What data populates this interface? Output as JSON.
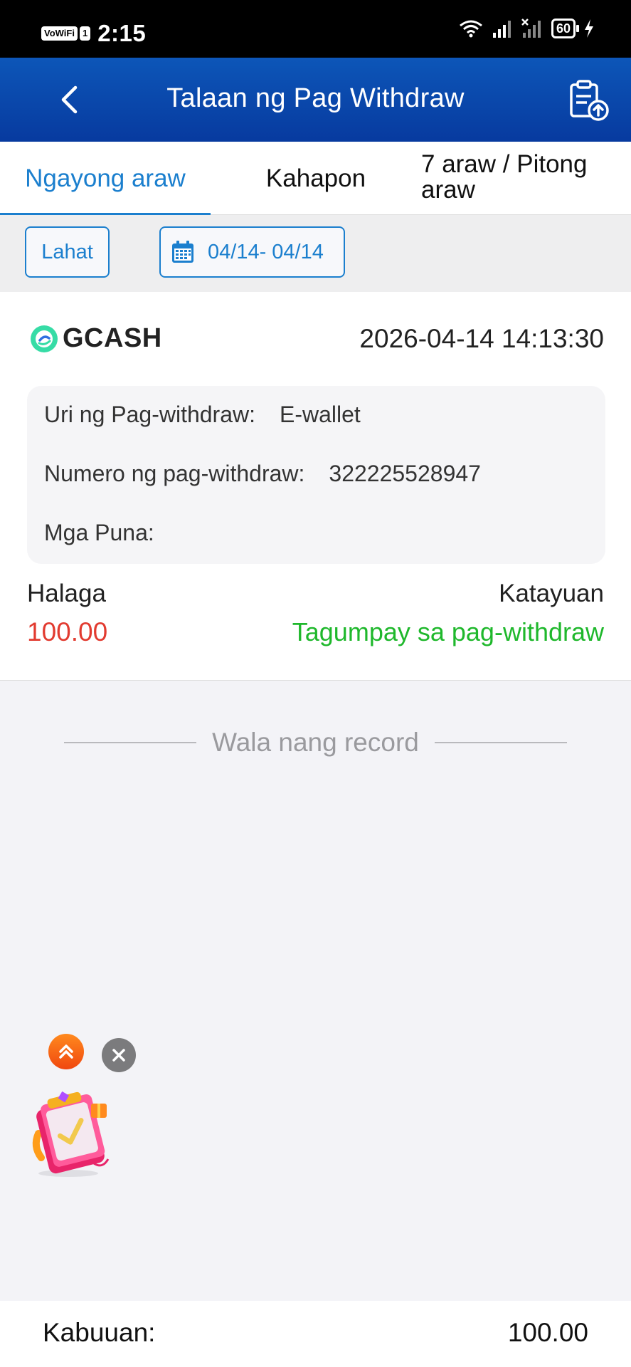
{
  "status_bar": {
    "network_badge": "VoWiFi",
    "sim_badge": "1",
    "time": "2:15",
    "battery": "60",
    "icons": [
      "wifi-icon",
      "signal-icon",
      "signal-x-icon",
      "battery-icon",
      "charging-icon"
    ]
  },
  "header": {
    "title": "Talaan ng Pag Withdraw",
    "back_icon": "chevron-left-icon",
    "action_icon": "clipboard-upload-icon"
  },
  "tabs": [
    {
      "label": "Ngayong araw",
      "active": true
    },
    {
      "label": "Kahapon",
      "active": false
    },
    {
      "label": "7 araw / Pitong araw",
      "active": false
    }
  ],
  "filters": {
    "all_label": "Lahat",
    "date_range": "04/14- 04/14",
    "date_icon": "calendar-icon"
  },
  "record": {
    "provider": "GCASH",
    "timestamp": "2026-04-14 14:13:30",
    "type_label": "Uri ng Pag-withdraw:",
    "type_value": "E-wallet",
    "number_label": "Numero ng pag-withdraw:",
    "number_value": "322225528947",
    "remarks_label": "Mga Puna:",
    "remarks_value": "",
    "amount_label": "Halaga",
    "amount_value": "100.00",
    "status_label": "Katayuan",
    "status_value": "Tagumpay sa pag-withdraw",
    "colors": {
      "amount": "#e23b30",
      "status": "#1fb82c"
    }
  },
  "no_more_text": "Wala nang record",
  "floating": {
    "scroll_top_icon": "double-chevron-up-icon",
    "close_icon": "close-icon",
    "promo_icon": "gift-book-icon"
  },
  "footer": {
    "total_label": "Kabuuan:",
    "total_value": "100.00"
  },
  "colors": {
    "header_gradient_top": "#0d56b8",
    "header_gradient_bottom": "#073a9f",
    "accent": "#1b7fce"
  }
}
